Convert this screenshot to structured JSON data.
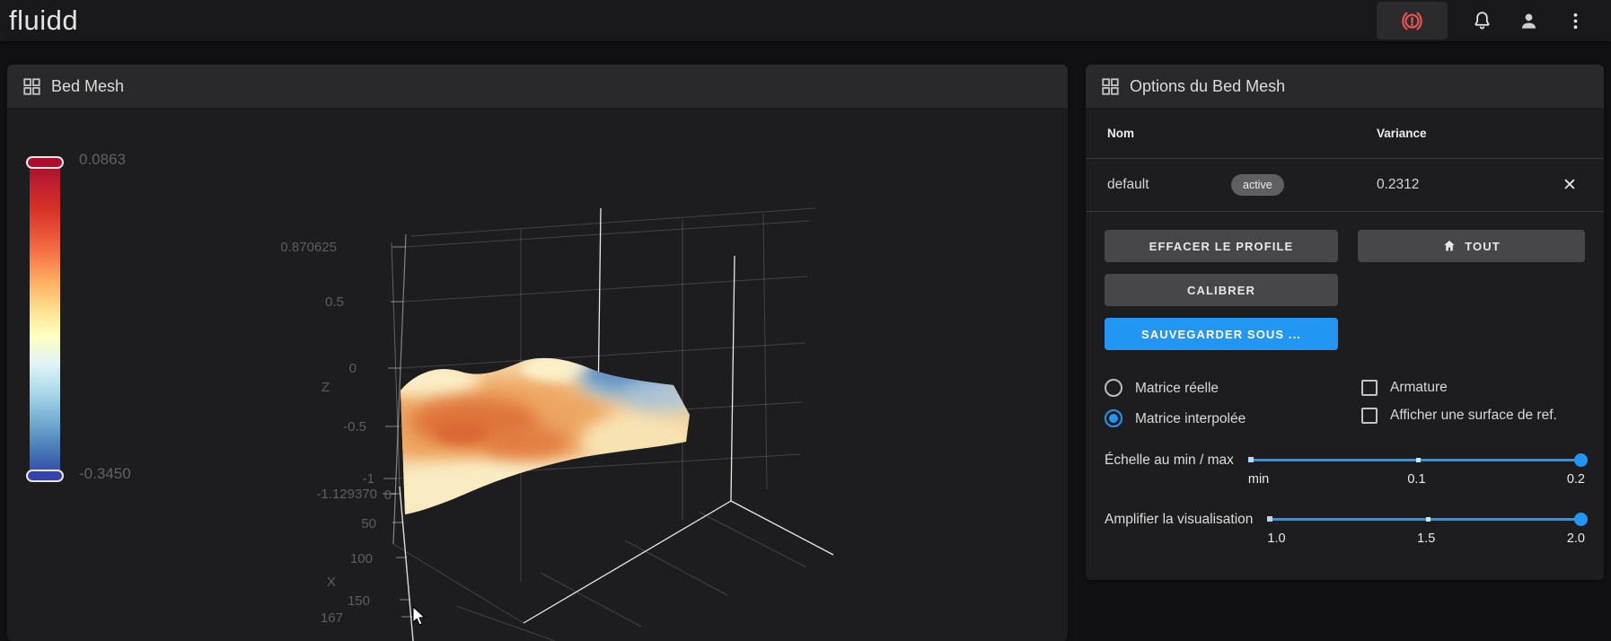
{
  "app": {
    "logo": "fluidd"
  },
  "topbar": {
    "icons": [
      "emergency-stop",
      "notifications-bell",
      "user",
      "overflow-menu"
    ]
  },
  "bed_mesh_panel": {
    "title": "Bed Mesh"
  },
  "options_panel": {
    "title": "Options du Bed Mesh",
    "table": {
      "headers": {
        "name": "Nom",
        "variance": "Variance"
      },
      "row": {
        "name": "default",
        "badge": "active",
        "variance": "0.2312"
      }
    },
    "buttons": {
      "clear": "EFFACER LE PROFILE",
      "home_all": "TOUT",
      "calibrate": "CALIBRER",
      "save_as": "SAUVEGARDER SOUS ..."
    },
    "radios": [
      {
        "label": "Matrice réelle",
        "selected": false
      },
      {
        "label": "Matrice interpolée",
        "selected": true
      }
    ],
    "checkboxes": [
      {
        "label": "Armature",
        "checked": false
      },
      {
        "label": "Afficher une surface de ref.",
        "checked": false
      }
    ],
    "sliders": [
      {
        "label": "Échelle au min / max",
        "ticks": [
          "min",
          "0.1",
          "0.2"
        ],
        "value": "0.2"
      },
      {
        "label": "Amplifier la visualisation",
        "ticks": [
          "1.0",
          "1.5",
          "2.0"
        ],
        "value": "2.0"
      }
    ],
    "colors": {
      "accent": "#2196f3",
      "button_gray": "#47474a",
      "estop_red": "#ef5350"
    }
  },
  "chart_data": {
    "type": "3d-surface",
    "title": "Bed Mesh",
    "profile": "default",
    "variance": 0.2312,
    "colorbar": {
      "max": "0.0863",
      "min": "-0.3450",
      "gradient": [
        "#9e0d28",
        "#d73027",
        "#f46d43",
        "#fdae61",
        "#fee090",
        "#ffffbf",
        "#e0f3f8",
        "#abd9e9",
        "#74add1",
        "#4575b4",
        "#3340a8"
      ]
    },
    "z_axis": {
      "label": "Z",
      "ticks": [
        "0.870625",
        "0.5",
        "0",
        "-0.5",
        "-1",
        "-1.129370"
      ],
      "range": [
        -1.12937,
        0.870625
      ]
    },
    "x_axis": {
      "label": "X",
      "ticks": [
        "0",
        "50",
        "100",
        "150",
        "167"
      ],
      "range": [
        0,
        167
      ]
    },
    "surface_summary": "warm orange/yellow mesh surface with high red-orange region left-center and low blue region at right edge"
  }
}
